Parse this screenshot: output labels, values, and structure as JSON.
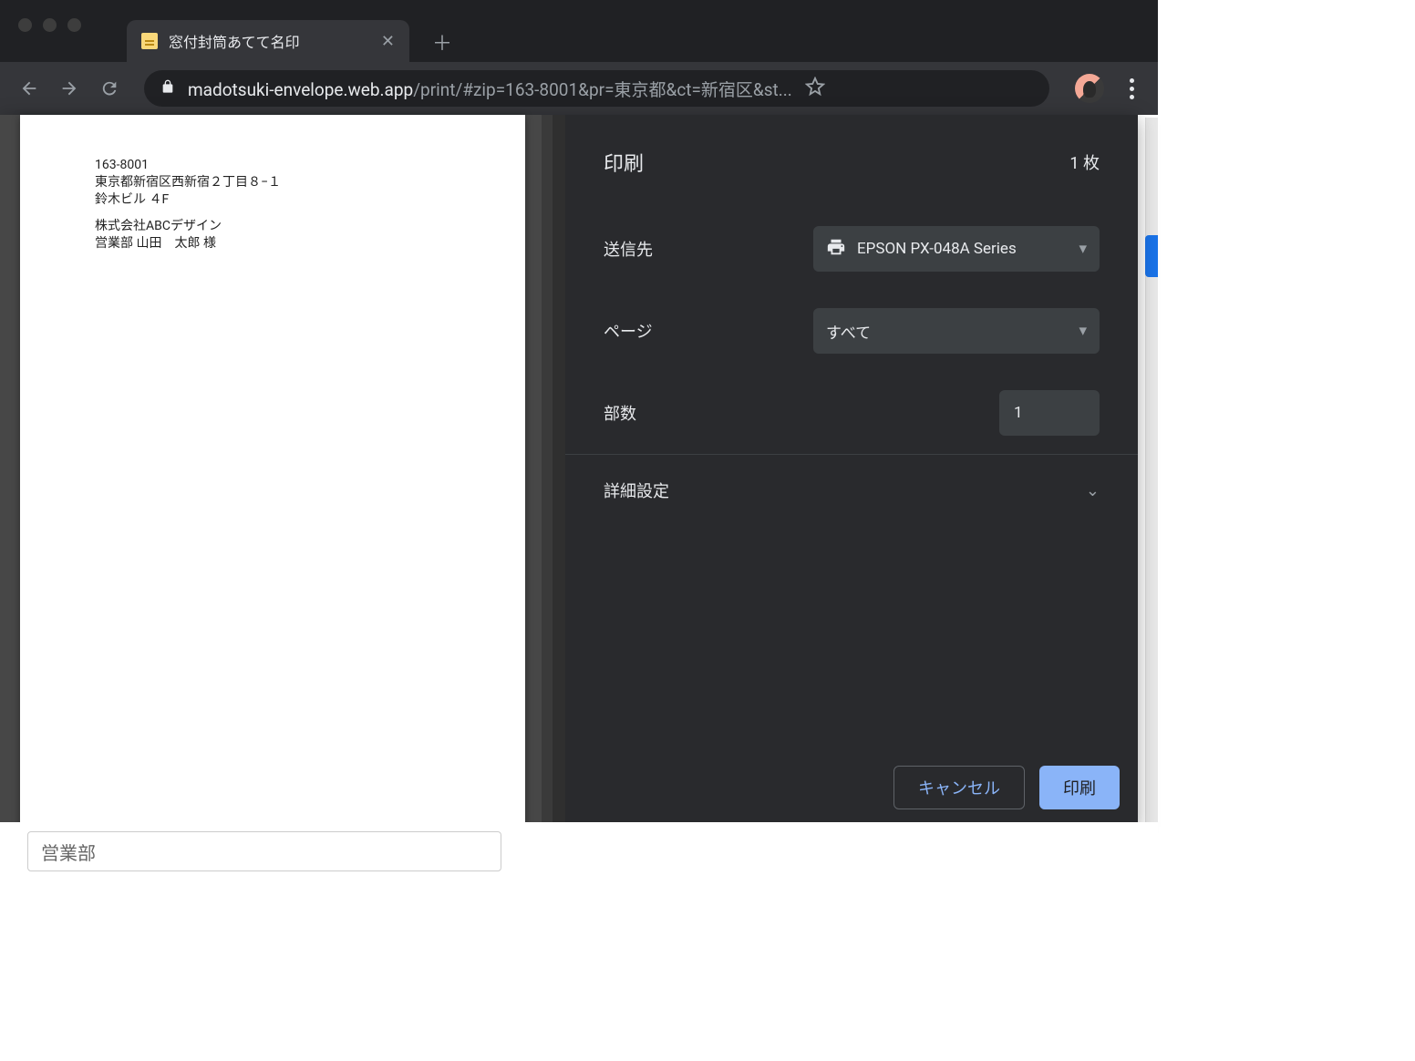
{
  "browser": {
    "tab_title": "窓付封筒あてて名印",
    "url_host": "madotsuki-envelope.web.app",
    "url_path": "/print/#zip=163-8001&pr=東京都&ct=新宿区&st..."
  },
  "preview": {
    "lines": [
      "163-8001",
      "東京都新宿区西新宿２丁目８−１",
      "鈴木ビル ４F",
      "株式会社ABCデザイン",
      "営業部 山田　太郎 様"
    ]
  },
  "print": {
    "title": "印刷",
    "sheet_count": "1 枚",
    "destination_label": "送信先",
    "destination_value": "EPSON PX-048A Series",
    "pages_label": "ページ",
    "pages_value": "すべて",
    "copies_label": "部数",
    "copies_value": "1",
    "more_label": "詳細設定",
    "cancel": "キャンセル",
    "print": "印刷"
  },
  "underlying": {
    "input_value": "営業部"
  }
}
